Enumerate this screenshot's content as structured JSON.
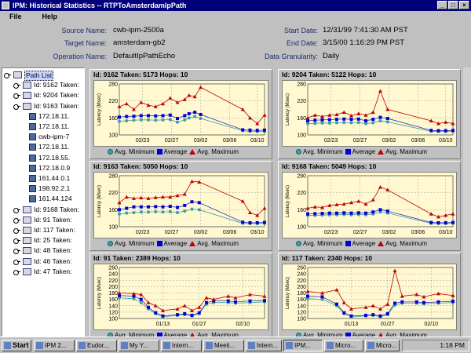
{
  "window": {
    "title": "IPM: Historical Statistics -- RTPToAmsterdamIpPath"
  },
  "menu": [
    "File",
    "Help"
  ],
  "info": {
    "source_label": "Source Name:",
    "source": "cwb-ipm-2500a",
    "target_label": "Target Name:",
    "target": "amsterdam-gb2",
    "operation_label": "Operation Name:",
    "operation": "DefaultIpPathEcho",
    "start_label": "Start Date:",
    "start": "12/31/99 7:41:30 AM PST",
    "end_label": "End Date:",
    "end": "3/15/00 1:16:29 PM PST",
    "granularity_label": "Data Granularity:",
    "granularity": "Daily"
  },
  "tree": {
    "root": "Path List",
    "items": [
      {
        "text": "Id: 9162 Taken:",
        "kind": "folder",
        "level": 1
      },
      {
        "text": "Id: 9204 Taken:",
        "kind": "folder",
        "level": 1
      },
      {
        "text": "Id: 9163 Taken:",
        "kind": "folder",
        "level": 1
      },
      {
        "text": "172.18.11.",
        "kind": "host",
        "level": 2
      },
      {
        "text": "172.18.11.",
        "kind": "host",
        "level": 2
      },
      {
        "text": "cwb-ipm-7",
        "kind": "host",
        "level": 2
      },
      {
        "text": "172.18.11.",
        "kind": "host",
        "level": 2
      },
      {
        "text": "172.18.55.",
        "kind": "host",
        "level": 2
      },
      {
        "text": "172.18.0.9",
        "kind": "host",
        "level": 2
      },
      {
        "text": "161.44.0.1",
        "kind": "host",
        "level": 2
      },
      {
        "text": "198.92.2.1",
        "kind": "host",
        "level": 2
      },
      {
        "text": "161.44.124",
        "kind": "host",
        "level": 2
      },
      {
        "text": "Id: 9168 Taken:",
        "kind": "folder",
        "level": 1
      },
      {
        "text": "Id:  91 Taken:",
        "kind": "folder",
        "level": 1
      },
      {
        "text": "Id: 117 Taken:",
        "kind": "folder",
        "level": 1
      },
      {
        "text": "Id:  25 Taken:",
        "kind": "folder",
        "level": 1
      },
      {
        "text": "Id:  48 Taken:",
        "kind": "folder",
        "level": 1
      },
      {
        "text": "Id:  46 Taken:",
        "kind": "folder",
        "level": 1
      },
      {
        "text": "Id:  47 Taken:",
        "kind": "folder",
        "level": 1
      }
    ]
  },
  "legend": {
    "min": "Avg. Minimum",
    "avg": "Average",
    "max": "Avg. Maximum"
  },
  "colors": {
    "min": "#3aa0a0",
    "avg": "#0000dd",
    "max": "#c00000",
    "plot_bg": "#fff8d0",
    "titlebar": "#00007b"
  },
  "chart_data": [
    {
      "type": "line",
      "title": "Id: 9162  Taken: 5173  Hops: 10",
      "ylabel": "Latency (Msec)",
      "ylim": [
        100,
        280
      ],
      "yticks": [
        100,
        160,
        220,
        280
      ],
      "xtick_labels": [
        "02/23",
        "02/27",
        "03/02",
        "03/06",
        "03/10"
      ],
      "xtick_pos": [
        0.16,
        0.36,
        0.56,
        0.76,
        0.95
      ],
      "series": [
        {
          "name": "Avg. Minimum",
          "x": [
            0,
            0.05,
            0.1,
            0.15,
            0.2,
            0.25,
            0.3,
            0.35,
            0.4,
            0.45,
            0.48,
            0.52,
            0.56,
            0.85,
            0.9,
            0.95,
            1.0
          ],
          "values": [
            148,
            150,
            152,
            153,
            153,
            152,
            153,
            154,
            145,
            153,
            160,
            165,
            158,
            115,
            112,
            112,
            112
          ]
        },
        {
          "name": "Average",
          "x": [
            0,
            0.05,
            0.1,
            0.15,
            0.2,
            0.25,
            0.3,
            0.35,
            0.4,
            0.45,
            0.48,
            0.52,
            0.56,
            0.85,
            0.9,
            0.95,
            1.0
          ],
          "values": [
            163,
            165,
            166,
            168,
            168,
            167,
            168,
            170,
            158,
            168,
            175,
            180,
            172,
            118,
            117,
            116,
            117
          ]
        },
        {
          "name": "Avg. Maximum",
          "x": [
            0,
            0.05,
            0.1,
            0.15,
            0.2,
            0.25,
            0.3,
            0.35,
            0.4,
            0.45,
            0.48,
            0.52,
            0.56,
            0.85,
            0.9,
            0.95,
            1.0
          ],
          "values": [
            200,
            210,
            190,
            215,
            205,
            200,
            210,
            230,
            215,
            225,
            240,
            235,
            268,
            190,
            160,
            140,
            170
          ]
        }
      ]
    },
    {
      "type": "line",
      "title": "Id: 9204  Taken: 5122  Hops: 10",
      "ylabel": "Latency (Msec)",
      "ylim": [
        100,
        280
      ],
      "yticks": [
        100,
        160,
        220,
        280
      ],
      "xtick_labels": [
        "02/23",
        "02/27",
        "03/02",
        "03/06",
        "03/10"
      ],
      "xtick_pos": [
        0.16,
        0.36,
        0.56,
        0.76,
        0.95
      ],
      "series": [
        {
          "name": "Avg. Minimum",
          "x": [
            0,
            0.05,
            0.1,
            0.15,
            0.2,
            0.25,
            0.3,
            0.35,
            0.4,
            0.45,
            0.5,
            0.55,
            0.85,
            0.9,
            0.95,
            1.0
          ],
          "values": [
            140,
            141,
            142,
            142,
            143,
            144,
            143,
            144,
            140,
            143,
            150,
            146,
            113,
            112,
            112,
            112
          ]
        },
        {
          "name": "Average",
          "x": [
            0,
            0.05,
            0.1,
            0.15,
            0.2,
            0.25,
            0.3,
            0.35,
            0.4,
            0.45,
            0.5,
            0.55,
            0.85,
            0.9,
            0.95,
            1.0
          ],
          "values": [
            150,
            152,
            153,
            154,
            155,
            156,
            155,
            156,
            150,
            155,
            162,
            158,
            116,
            115,
            115,
            116
          ]
        },
        {
          "name": "Avg. Maximum",
          "x": [
            0,
            0.05,
            0.1,
            0.15,
            0.2,
            0.25,
            0.3,
            0.35,
            0.4,
            0.45,
            0.5,
            0.55,
            0.85,
            0.9,
            0.95,
            1.0
          ],
          "values": [
            160,
            170,
            165,
            170,
            172,
            180,
            168,
            175,
            170,
            180,
            255,
            190,
            150,
            140,
            145,
            140
          ]
        }
      ]
    },
    {
      "type": "line",
      "title": "Id: 9163  Taken: 5050  Hops: 10",
      "ylabel": "Latency (Msec)",
      "ylim": [
        100,
        280
      ],
      "yticks": [
        100,
        160,
        220,
        280
      ],
      "xtick_labels": [
        "02/23",
        "02/27",
        "03/02",
        "03/06",
        "03/10"
      ],
      "xtick_pos": [
        0.16,
        0.36,
        0.56,
        0.76,
        0.95
      ],
      "series": [
        {
          "name": "Avg. Minimum",
          "x": [
            0,
            0.05,
            0.1,
            0.15,
            0.2,
            0.25,
            0.3,
            0.35,
            0.4,
            0.45,
            0.5,
            0.55,
            0.85,
            0.9,
            0.95,
            1.0
          ],
          "values": [
            145,
            148,
            150,
            152,
            152,
            153,
            152,
            153,
            150,
            155,
            162,
            160,
            112,
            111,
            111,
            112
          ]
        },
        {
          "name": "Average",
          "x": [
            0,
            0.05,
            0.1,
            0.15,
            0.2,
            0.25,
            0.3,
            0.35,
            0.4,
            0.45,
            0.5,
            0.55,
            0.85,
            0.9,
            0.95,
            1.0
          ],
          "values": [
            160,
            165,
            170,
            170,
            170,
            171,
            170,
            172,
            168,
            175,
            188,
            185,
            116,
            114,
            114,
            115
          ]
        },
        {
          "name": "Avg. Maximum",
          "x": [
            0,
            0.05,
            0.1,
            0.15,
            0.2,
            0.25,
            0.3,
            0.35,
            0.4,
            0.45,
            0.5,
            0.55,
            0.85,
            0.9,
            0.95,
            1.0
          ],
          "values": [
            185,
            205,
            200,
            202,
            200,
            203,
            205,
            205,
            210,
            215,
            260,
            258,
            190,
            150,
            140,
            165
          ]
        }
      ]
    },
    {
      "type": "line",
      "title": "Id: 9168  Taken: 5049  Hops: 10",
      "ylabel": "Latency (Msec)",
      "ylim": [
        100,
        280
      ],
      "yticks": [
        100,
        160,
        220,
        280
      ],
      "xtick_labels": [
        "02/23",
        "02/27",
        "03/02",
        "03/06",
        "03/10"
      ],
      "xtick_pos": [
        0.16,
        0.36,
        0.56,
        0.76,
        0.95
      ],
      "series": [
        {
          "name": "Avg. Minimum",
          "x": [
            0,
            0.05,
            0.1,
            0.15,
            0.2,
            0.25,
            0.3,
            0.35,
            0.4,
            0.45,
            0.5,
            0.55,
            0.85,
            0.9,
            0.95,
            1.0
          ],
          "values": [
            140,
            140,
            141,
            142,
            142,
            143,
            142,
            143,
            142,
            145,
            152,
            148,
            112,
            111,
            111,
            112
          ]
        },
        {
          "name": "Average",
          "x": [
            0,
            0.05,
            0.1,
            0.15,
            0.2,
            0.25,
            0.3,
            0.35,
            0.4,
            0.45,
            0.5,
            0.55,
            0.85,
            0.9,
            0.95,
            1.0
          ],
          "values": [
            145,
            146,
            147,
            148,
            148,
            149,
            148,
            149,
            148,
            152,
            160,
            155,
            115,
            114,
            114,
            115
          ]
        },
        {
          "name": "Avg. Maximum",
          "x": [
            0,
            0.05,
            0.1,
            0.15,
            0.2,
            0.25,
            0.3,
            0.35,
            0.4,
            0.45,
            0.5,
            0.55,
            0.85,
            0.9,
            0.95,
            1.0
          ],
          "values": [
            165,
            170,
            168,
            175,
            178,
            180,
            185,
            190,
            180,
            195,
            240,
            230,
            145,
            135,
            140,
            145
          ]
        }
      ]
    },
    {
      "type": "line",
      "title": "Id: 91  Taken: 2389  Hops: 10",
      "ylabel": "Latency (Msec)",
      "ylim": [
        100,
        260
      ],
      "yticks": [
        100,
        120,
        140,
        160,
        180,
        200,
        220,
        240,
        260
      ],
      "xtick_labels": [
        "01/13",
        "01/27",
        "02/10"
      ],
      "xtick_pos": [
        0.3,
        0.55,
        0.85
      ],
      "series": [
        {
          "name": "Avg. Minimum",
          "x": [
            0,
            0.1,
            0.15,
            0.2,
            0.25,
            0.3,
            0.4,
            0.45,
            0.5,
            0.55,
            0.6,
            0.65,
            0.75,
            0.8,
            0.9,
            1.0
          ],
          "values": [
            165,
            162,
            150,
            130,
            115,
            105,
            110,
            112,
            108,
            115,
            145,
            150,
            150,
            148,
            150,
            152
          ]
        },
        {
          "name": "Average",
          "x": [
            0,
            0.1,
            0.15,
            0.2,
            0.25,
            0.3,
            0.4,
            0.45,
            0.5,
            0.55,
            0.6,
            0.65,
            0.75,
            0.8,
            0.9,
            1.0
          ],
          "values": [
            172,
            170,
            160,
            135,
            118,
            108,
            112,
            115,
            110,
            118,
            150,
            155,
            155,
            152,
            155,
            156
          ]
        },
        {
          "name": "Avg. Maximum",
          "x": [
            0,
            0.1,
            0.15,
            0.2,
            0.25,
            0.3,
            0.4,
            0.45,
            0.5,
            0.55,
            0.6,
            0.65,
            0.75,
            0.8,
            0.9,
            1.0
          ],
          "values": [
            180,
            178,
            175,
            150,
            140,
            125,
            130,
            140,
            125,
            135,
            165,
            160,
            170,
            165,
            175,
            170
          ]
        }
      ]
    },
    {
      "type": "line",
      "title": "Id: 117  Taken: 2340  Hops: 10",
      "ylabel": "Latency (Msec)",
      "ylim": [
        100,
        260
      ],
      "yticks": [
        100,
        120,
        140,
        160,
        180,
        200,
        220,
        240,
        260
      ],
      "xtick_labels": [
        "01/13",
        "01/27",
        "02/10"
      ],
      "xtick_pos": [
        0.3,
        0.55,
        0.85
      ],
      "series": [
        {
          "name": "Avg. Minimum",
          "x": [
            0,
            0.1,
            0.2,
            0.25,
            0.3,
            0.4,
            0.45,
            0.5,
            0.55,
            0.6,
            0.65,
            0.75,
            0.8,
            0.9,
            1.0
          ],
          "values": [
            162,
            160,
            140,
            115,
            105,
            108,
            110,
            106,
            112,
            142,
            148,
            148,
            146,
            148,
            150
          ]
        },
        {
          "name": "Average",
          "x": [
            0,
            0.1,
            0.2,
            0.25,
            0.3,
            0.4,
            0.45,
            0.5,
            0.55,
            0.6,
            0.65,
            0.75,
            0.8,
            0.9,
            1.0
          ],
          "values": [
            170,
            168,
            145,
            118,
            108,
            110,
            112,
            108,
            115,
            148,
            152,
            152,
            150,
            152,
            154
          ]
        },
        {
          "name": "Avg. Maximum",
          "x": [
            0,
            0.1,
            0.2,
            0.25,
            0.3,
            0.4,
            0.45,
            0.5,
            0.55,
            0.6,
            0.65,
            0.75,
            0.8,
            0.9,
            1.0
          ],
          "values": [
            185,
            180,
            190,
            150,
            130,
            135,
            140,
            130,
            145,
            250,
            170,
            175,
            168,
            178,
            172
          ]
        }
      ]
    }
  ],
  "taskbar": {
    "start": "Start",
    "items": [
      "IPM 2...",
      "Eudor...",
      "My Y...",
      "Intern...",
      "Meeti...",
      "Intern...",
      "IPM...",
      "Micro...",
      "Micro..."
    ],
    "clock": "1:18 PM"
  }
}
